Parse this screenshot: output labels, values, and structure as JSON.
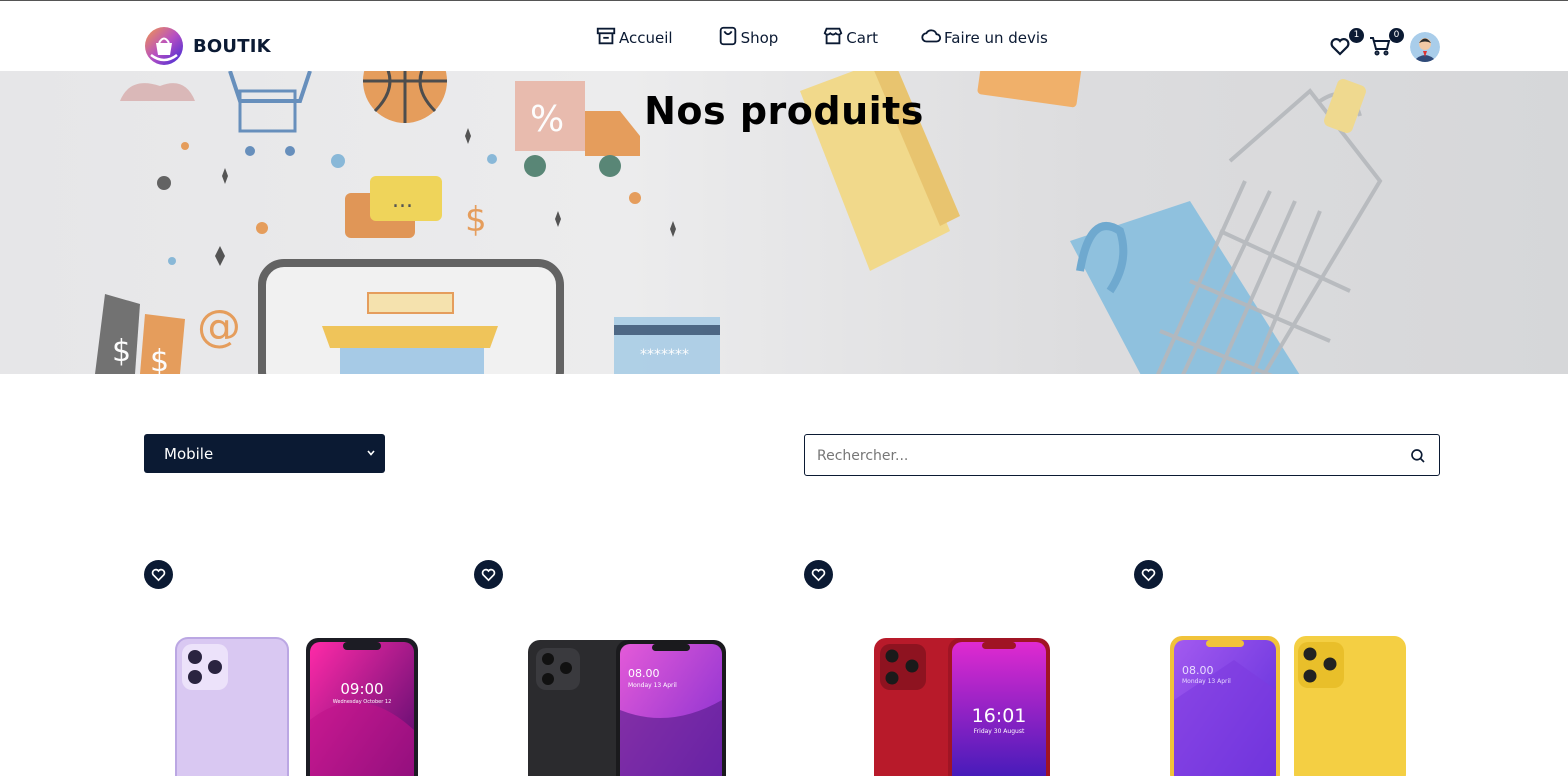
{
  "brand": {
    "name": "BOUTIK",
    "logo_icon": "shopping-bag-logo"
  },
  "nav": {
    "items": [
      {
        "label": "Accueil",
        "icon": "store-icon"
      },
      {
        "label": "Shop",
        "icon": "bag-icon"
      },
      {
        "label": "Cart",
        "icon": "shop-front-icon"
      },
      {
        "label": "Faire un devis",
        "icon": "cloud-icon"
      }
    ]
  },
  "header_icons": {
    "wishlist_count": "1",
    "cart_count": "0"
  },
  "hero": {
    "title": "Nos produits"
  },
  "filters": {
    "category_selected": "Mobile",
    "search_placeholder": "Rechercher..."
  },
  "products": [
    {
      "image": "purple-pink-phone",
      "screen_time": "09:00",
      "screen_date": "Wednesday October 12"
    },
    {
      "image": "black-magenta-phone",
      "screen_time": "08.00",
      "screen_date": "Monday 13 April"
    },
    {
      "image": "red-phone",
      "screen_time": "16:01",
      "screen_date": "Friday 30 August"
    },
    {
      "image": "yellow-phone",
      "screen_time": "08.00",
      "screen_date": "Monday 13 April"
    }
  ],
  "colors": {
    "primary": "#0b1a33",
    "background": "#ffffff"
  }
}
